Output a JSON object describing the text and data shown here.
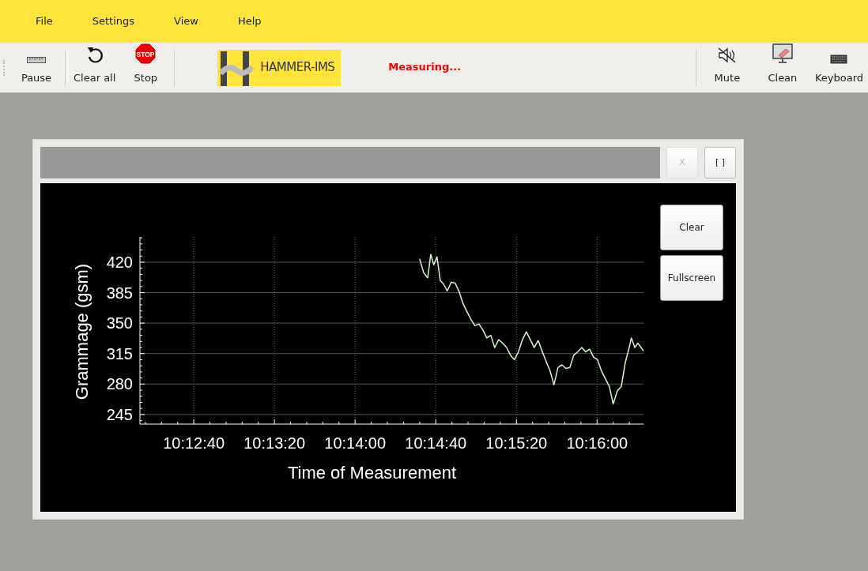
{
  "menu": [
    {
      "label": "File"
    },
    {
      "label": "Settings"
    },
    {
      "label": "View"
    },
    {
      "label": "Help"
    }
  ],
  "toolbar_left": [
    {
      "kind": "ruler",
      "label": "Pause"
    },
    {
      "kind": "undo",
      "label": "Clear all"
    },
    {
      "kind": "stop",
      "label": "Stop",
      "icon_text": "STOP"
    }
  ],
  "logo": {
    "text": "HAMMER-IMS"
  },
  "status": "Measuring...",
  "toolbar_right": [
    {
      "kind": "mute",
      "label": "Mute"
    },
    {
      "kind": "clean",
      "label": "Clean"
    },
    {
      "kind": "keyboard",
      "label": "Keyboard"
    }
  ],
  "panel": {
    "header_buttons": [
      {
        "label": "X",
        "disabled": true
      },
      {
        "label": "[ ]",
        "disabled": false
      }
    ],
    "side_buttons": [
      {
        "label": "Clear"
      },
      {
        "label": "Fullscreen"
      }
    ],
    "chart_data": {
      "type": "line",
      "grid": true,
      "xlabel": "Time of Measurement",
      "ylabel": "Grammage (gsm)",
      "xlim": [
        36733.3,
        36983
      ],
      "ylim": [
        234,
        449
      ],
      "xticks": [
        {
          "value": 36760,
          "label": "10:12:40"
        },
        {
          "value": 36800,
          "label": "10:13:20"
        },
        {
          "value": 36840,
          "label": "10:14:00"
        },
        {
          "value": 36880,
          "label": "10:14:40"
        },
        {
          "value": 36920,
          "label": "10:15:20"
        },
        {
          "value": 36960,
          "label": "10:16:00"
        }
      ],
      "yticks": [
        245,
        280,
        315,
        350,
        385,
        420
      ],
      "x": [
        36872,
        36874,
        36876,
        36877.5,
        36879,
        36880.6,
        36882.2,
        36883.8,
        36885.7,
        36887.7,
        36889.6,
        36891.6,
        36893.6,
        36895.5,
        36897.5,
        36899.4,
        36901.4,
        36903.4,
        36905.3,
        36907.3,
        36909.2,
        36911.2,
        36913.2,
        36915.1,
        36917.1,
        36919,
        36921,
        36923,
        36924.9,
        36926.9,
        36928.8,
        36930.8,
        36932.7,
        36934.7,
        36936.7,
        36938.6,
        36940.6,
        36942.6,
        36944.5,
        36946.5,
        36948.4,
        36950.4,
        36952.4,
        36954.3,
        36956.3,
        36958.2,
        36960.2,
        36962.2,
        36964.1,
        36966.1,
        36968,
        36970,
        36972,
        36973.9,
        36975.9,
        36977,
        36978.7,
        36980.2,
        36981.8,
        36983
      ],
      "series": [
        {
          "color": "#d8f5d0",
          "values": [
            424,
            408,
            402,
            429,
            417,
            426,
            399,
            395,
            387,
            397,
            396,
            386,
            372,
            363,
            354,
            347,
            349,
            342,
            333,
            336,
            322,
            331,
            327,
            322,
            313,
            308,
            317,
            331,
            340,
            331,
            322,
            330,
            318,
            306,
            295,
            279,
            299,
            302,
            298,
            299,
            313,
            317,
            322,
            317,
            320,
            311,
            308,
            295,
            286,
            277,
            257,
            272,
            277,
            304,
            322,
            333,
            322,
            327,
            322,
            318
          ]
        }
      ]
    }
  }
}
